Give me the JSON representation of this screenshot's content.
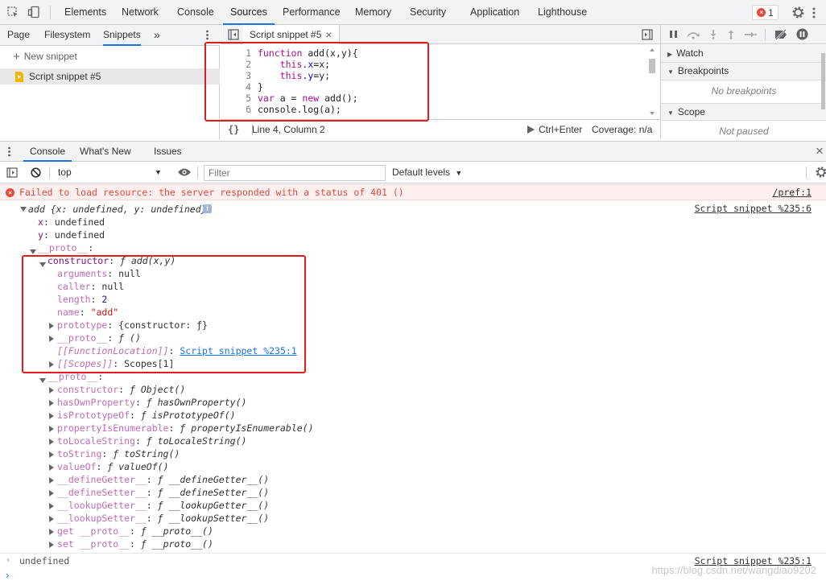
{
  "top_tabs": [
    "Elements",
    "Network",
    "Console",
    "Sources",
    "Performance",
    "Memory",
    "Security",
    "Application",
    "Lighthouse"
  ],
  "active_top_tab": "Sources",
  "error_count": "1",
  "navigator": {
    "tabs": [
      "Page",
      "Filesystem",
      "Snippets"
    ],
    "more": "»",
    "new_snippet": "New snippet",
    "snippet_item": "Script snippet #5"
  },
  "editor": {
    "tab_label": "Script snippet #5",
    "close": "×",
    "code_lines": [
      {
        "n": "1",
        "text": "function add(x,y){"
      },
      {
        "n": "2",
        "text": "    this.x=x;"
      },
      {
        "n": "3",
        "text": "    this.y=y;"
      },
      {
        "n": "4",
        "text": "}"
      },
      {
        "n": "5",
        "text": "var a = new add();"
      },
      {
        "n": "6",
        "text": "console.log(a);"
      }
    ],
    "status_braces": "{}",
    "status_position": "Line 4, Column 2",
    "run_label": "Ctrl+Enter",
    "coverage": "Coverage: n/a"
  },
  "debugger": {
    "sections": [
      "Watch",
      "Breakpoints",
      "Scope"
    ],
    "no_breakpoints": "No breakpoints",
    "not_paused": "Not paused"
  },
  "drawer": {
    "tabs": [
      "Console",
      "What's New",
      "Issues"
    ],
    "close": "×"
  },
  "console_toolbar": {
    "context": "top",
    "filter_placeholder": "Filter",
    "levels": "Default levels"
  },
  "error_message": {
    "text": "Failed to load resource: the server responded with a status of 401 ()",
    "source": "/pref:1"
  },
  "log": {
    "source": "Script snippet %235:6",
    "summary": "add {x: undefined, y: undefined}",
    "x": "undefined",
    "y": "undefined",
    "proto_label": "__proto__",
    "constructor": {
      "key": "constructor",
      "value": "add(x,y)",
      "fn": "ƒ",
      "props": [
        {
          "k": "arguments",
          "v": "null",
          "t": "n"
        },
        {
          "k": "caller",
          "v": "null",
          "t": "n"
        },
        {
          "k": "length",
          "v": "2",
          "t": "num"
        },
        {
          "k": "name",
          "v": "\"add\"",
          "t": "str"
        }
      ],
      "prototype_key": "prototype",
      "prototype_val": "{constructor: ƒ}",
      "proto2_key": "__proto__",
      "proto2_val": "ƒ ()",
      "fnloc_key": "[[FunctionLocation]]",
      "fnloc_val": "Script snippet %235:1",
      "scopes_key": "[[Scopes]]",
      "scopes_val": "Scopes[1]"
    },
    "object_proto": [
      {
        "k": "constructor",
        "v": "Object()"
      },
      {
        "k": "hasOwnProperty",
        "v": "hasOwnProperty()"
      },
      {
        "k": "isPrototypeOf",
        "v": "isPrototypeOf()"
      },
      {
        "k": "propertyIsEnumerable",
        "v": "propertyIsEnumerable()"
      },
      {
        "k": "toLocaleString",
        "v": "toLocaleString()"
      },
      {
        "k": "toString",
        "v": "toString()"
      },
      {
        "k": "valueOf",
        "v": "valueOf()"
      },
      {
        "k": "__defineGetter__",
        "v": "__defineGetter__()"
      },
      {
        "k": "__defineSetter__",
        "v": "__defineSetter__()"
      },
      {
        "k": "__lookupGetter__",
        "v": "__lookupGetter__()"
      },
      {
        "k": "__lookupSetter__",
        "v": "__lookupSetter__()"
      },
      {
        "k": "get __proto__",
        "v": "__proto__()"
      },
      {
        "k": "set __proto__",
        "v": "__proto__()"
      }
    ]
  },
  "result": {
    "text": "undefined",
    "source": "Script snippet %235:1"
  },
  "watermark": "https://blog.csdn.net/wangdiao9202"
}
